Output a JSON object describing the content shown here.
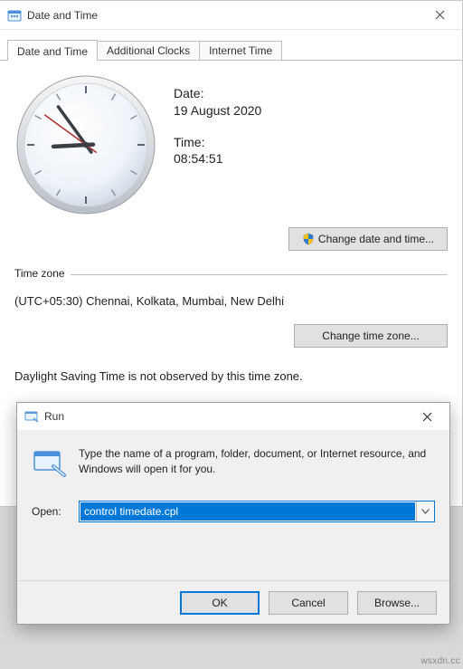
{
  "dt": {
    "title": "Date and Time",
    "tabs": [
      "Date and Time",
      "Additional Clocks",
      "Internet Time"
    ],
    "date_label": "Date:",
    "date_value": "19 August 2020",
    "time_label": "Time:",
    "time_value": "08:54:51",
    "change_dt_btn": "Change date and time...",
    "tz_label": "Time zone",
    "tz_value": "(UTC+05:30) Chennai, Kolkata, Mumbai, New Delhi",
    "change_tz_btn": "Change time zone...",
    "dst_text": "Daylight Saving Time is not observed by this time zone."
  },
  "clock": {
    "hour": 8,
    "minute": 54,
    "second": 51
  },
  "run": {
    "title": "Run",
    "message": "Type the name of a program, folder, document, or Internet resource, and Windows will open it for you.",
    "open_label": "Open:",
    "open_value": "control timedate.cpl",
    "ok": "OK",
    "cancel": "Cancel",
    "browse": "Browse..."
  },
  "watermark": "wsxdn.cc"
}
